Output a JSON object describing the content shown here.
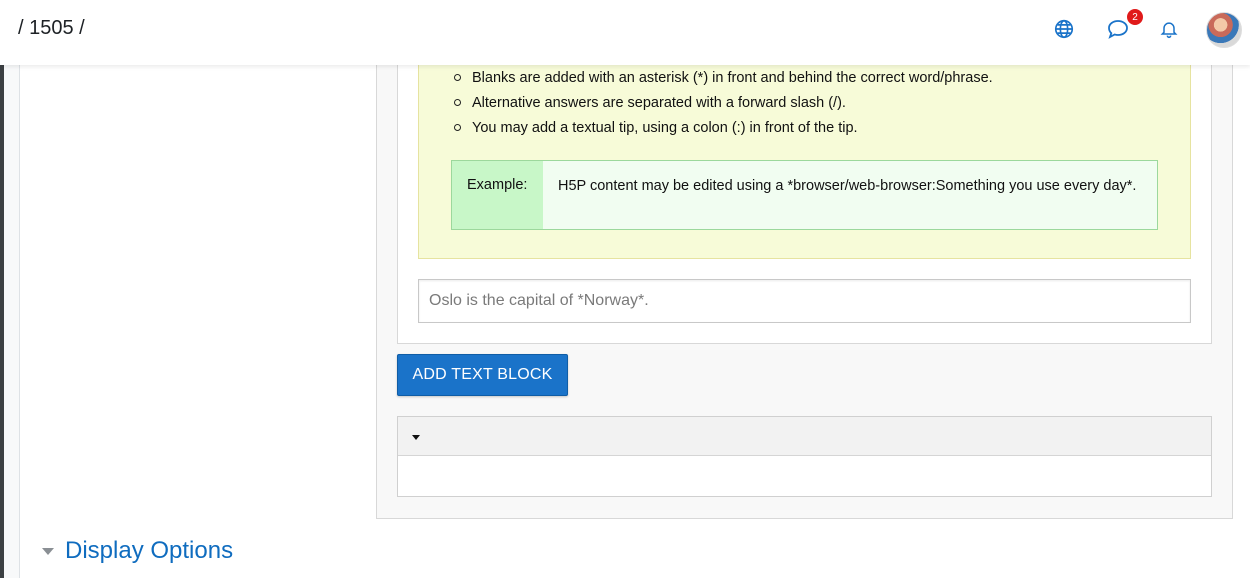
{
  "header": {
    "breadcrumb": "/ 1505 /",
    "messages_badge_count": "2",
    "icons": [
      "globe-icon",
      "chat-bubble-icon",
      "bell-icon"
    ]
  },
  "help": {
    "items": [
      "Blanks are added with an asterisk (*) in front and behind the correct word/phrase.",
      "Alternative answers are separated with a forward slash (/).",
      "You may add a textual tip, using a colon (:) in front of the tip."
    ],
    "example_label": "Example:",
    "example_text": "H5P content may be edited using a *browser/web-browser:Something you use every day*."
  },
  "editor": {
    "text_placeholder": "Oslo is the capital of *Norway*.",
    "add_button_label": "ADD TEXT BLOCK"
  },
  "section": {
    "display_options_label": "Display Options"
  },
  "colors": {
    "accent": "#1a73c9",
    "link": "#0f6cbf",
    "help_bg": "#f7fbd8",
    "example_label_bg": "#c8f7c8",
    "badge": "#e01a1a"
  }
}
